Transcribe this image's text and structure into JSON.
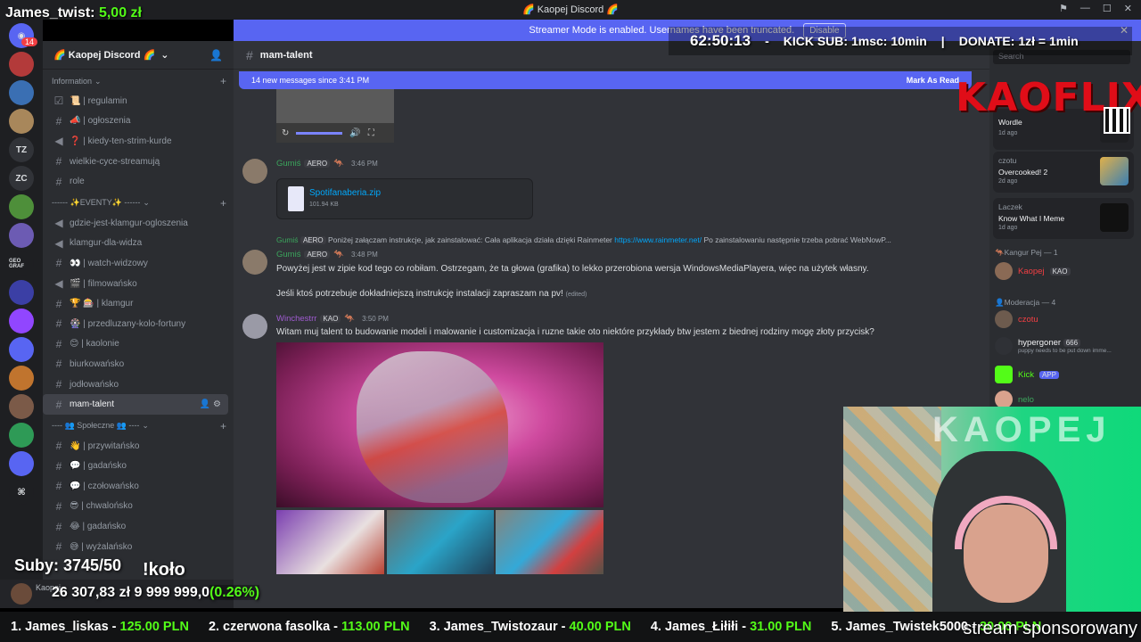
{
  "window": {
    "title": "🌈 Kaopej Discord 🌈"
  },
  "streamer_banner": {
    "text": "Streamer Mode is enabled. Usernames have been truncated.",
    "disable_label": "Disable"
  },
  "server": {
    "name": "🌈 Kaopej Discord 🌈",
    "rail": [
      "TZ",
      "ZC",
      "GEO GRAF"
    ],
    "rail_badge": "14"
  },
  "sidebar": {
    "categories": [
      {
        "name": "Information",
        "channels": [
          "📜 | regulamin",
          "📣 | ogłoszenia",
          "❓ | kiedy-ten-strim-kurde",
          "wielkie-cyce-streamują",
          "role"
        ]
      },
      {
        "name": "------ ✨EVENTY✨ ------",
        "channels": [
          "gdzie-jest-klamgur-ogloszenia",
          "klamgur-dla-widza",
          "👀 | watch-widzowy",
          "🎬 | filmowańsko",
          "🏆 🎰 | klamgur",
          "🎡 | przedluzany-kolo-fortuny",
          "😊 | kaolonie",
          "biurkowańsko",
          "jodłowańsko",
          "mam-talent"
        ]
      },
      {
        "name": "---- 👥 Społeczne 👥 ----",
        "channels": [
          "👋 | przywitańsko",
          "💬 | gadańsko",
          "💬 | czołowańsko",
          "😎 | chwalońsko",
          "😂 | gadańsko",
          "😅 | wyżalańsko"
        ]
      }
    ],
    "active_channel": "mam-talent",
    "user_panel_name": "Kaopej"
  },
  "chat": {
    "channel": "mam-talent",
    "new_messages": "14 new messages since 3:41 PM",
    "mark_as_read": "Mark As Read",
    "messages": [
      {
        "author": "Gumiś",
        "tag": "AERO",
        "time": "3:46 PM",
        "file_name": "Spotifanaberia.zip",
        "file_size": "101.94 KB"
      },
      {
        "reply_author": "Gumiś",
        "reply_tag": "AERO",
        "reply_text": "Poniżej załączam instrukcje, jak zainstalować:  Cała aplikacja działa dzięki Rainmeter",
        "reply_link": "https://www.rainmeter.net/",
        "reply_tail": "Po zainstalowaniu następnie trzeba pobrać WebNowP...",
        "author": "Gumiś",
        "tag": "AERO",
        "time": "3:48 PM",
        "line1": "Powyżej jest w zipie kod tego co robiłam. Ostrzegam, że ta głowa (grafika) to lekko przerobiona wersja WindowsMediaPlayera, więc na użytek własny.",
        "line2": "Jeśli ktoś potrzebuje dokładniejszą instrukcję instalacji zapraszam na pv!",
        "edited": "(edited)"
      },
      {
        "author": "Winchestrr",
        "tag": "KAO",
        "time": "3:50 PM",
        "text": "Witam muj talent to budowanie modeli i malowanie i customizacja i ruzne takie oto niektóre przykłady btw jestem z biednej rodziny mogę złoty przycisk?"
      }
    ]
  },
  "members": {
    "search_placeholder": "Search",
    "activities": [
      {
        "what": "Wordle",
        "ago": "1d ago"
      },
      {
        "who": "czotu",
        "what": "Overcooked! 2",
        "ago": "2d ago"
      },
      {
        "who": "Laczek",
        "what": "Know What I Meme",
        "ago": "1d ago"
      }
    ],
    "groups": [
      {
        "label": "🦘Kangur Pej — 1",
        "members": [
          {
            "name": "Kaopej",
            "tag": "KAO"
          }
        ]
      },
      {
        "label": "👤Moderacja — 4",
        "members": [
          {
            "name": "czotu"
          },
          {
            "name": "hypergoner",
            "tag": "666",
            "sub": "puppy needs to be put down imme..."
          },
          {
            "name": "Kick",
            "tag": "APP"
          },
          {
            "name": "nelo"
          }
        ]
      }
    ]
  },
  "overlay": {
    "top_name": "James_twist:",
    "top_amount": "5,00 zł",
    "timer": "62:50:13",
    "kick_sub": "KICK SUB: 1msc: 10min",
    "donate": "DONATE: 1zł = 1min",
    "brand": "KAOFLIX",
    "webcam_text": "KAOPEJ",
    "subs": "Suby: 3745/50",
    "kolo": "!koło",
    "goal_current": "26 307,83 zł",
    "goal_target": "9 999 999,0",
    "goal_pct": "(0.26%)",
    "ticker": [
      {
        "rank": "1. James_liskas -",
        "amount": "125.00 PLN"
      },
      {
        "rank": "2. czerwona fasolka -",
        "amount": "113.00 PLN"
      },
      {
        "rank": "3. James_Twistozaur -",
        "amount": "40.00 PLN"
      },
      {
        "rank": "4. James_Łiłiłi -",
        "amount": "31.00 PLN"
      },
      {
        "rank": "5. James_Twistek5000 -",
        "amount": "30.00 PLN"
      }
    ],
    "sponsor": "stream sponsorowany"
  },
  "colors": {
    "accent": "#5865f2",
    "kick_green": "#53fc18",
    "kaoflix_red": "#e00d18"
  }
}
